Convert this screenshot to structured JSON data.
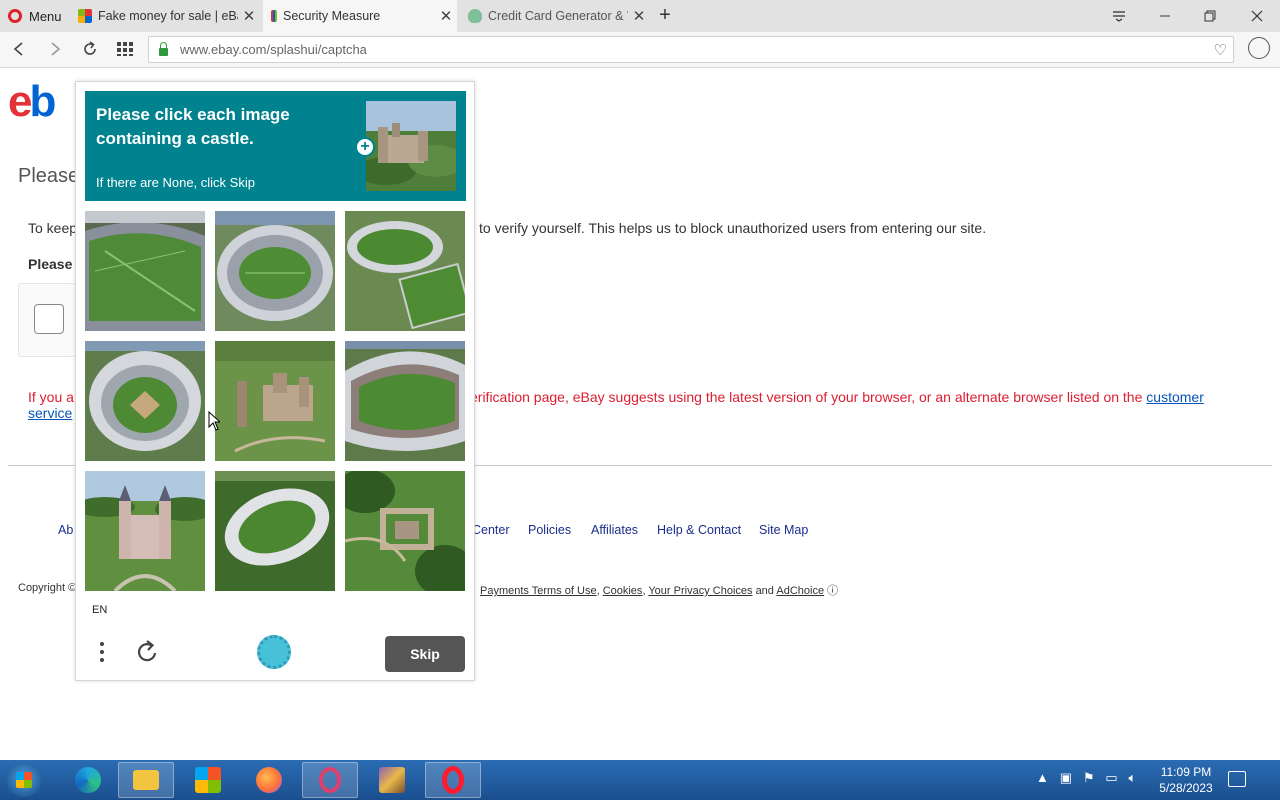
{
  "browser": {
    "menu_label": "Menu",
    "tabs": [
      {
        "title": "Fake money for sale | eBay"
      },
      {
        "title": "Security Measure"
      },
      {
        "title": "Credit Card Generator & V"
      }
    ],
    "url": "www.ebay.com/splashui/captcha"
  },
  "page": {
    "heading": "Please",
    "intro_left": "To keep",
    "intro_right": "to verify yourself. This helps us to block unauthorized users from entering our site.",
    "please_bold": "Please",
    "warn_left": "If you a",
    "warn_left2": "service",
    "warn_right": "erification page, eBay suggests using the latest version of your browser, or an alternate browser listed on the",
    "warn_link": "customer",
    "footer_left": "Ab",
    "footer_links": [
      "Center",
      "Policies",
      "Affiliates",
      "Help & Contact",
      "Site Map"
    ],
    "copyright_left": "Copyright ©",
    "copyright_links": [
      "Payments Terms of Use",
      "Cookies",
      "Your Privacy Choices",
      "AdChoice"
    ],
    "copyright_and": "and"
  },
  "captcha": {
    "title": "Please click each image containing a castle.",
    "subtitle": "If there are None, click Skip",
    "language": "EN",
    "skip_label": "Skip",
    "tiles": [
      "stadium",
      "stadium",
      "stadium",
      "stadium",
      "castle",
      "stadium",
      "castle",
      "stadium",
      "castle"
    ]
  },
  "taskbar": {
    "time": "11:09 PM",
    "date": "5/28/2023"
  },
  "colors": {
    "captcha_header": "#00838f",
    "ebay_red": "#e53238",
    "ebay_blue": "#0064d2",
    "warning_red": "#dd1e31",
    "link_blue": "#0654ba"
  }
}
